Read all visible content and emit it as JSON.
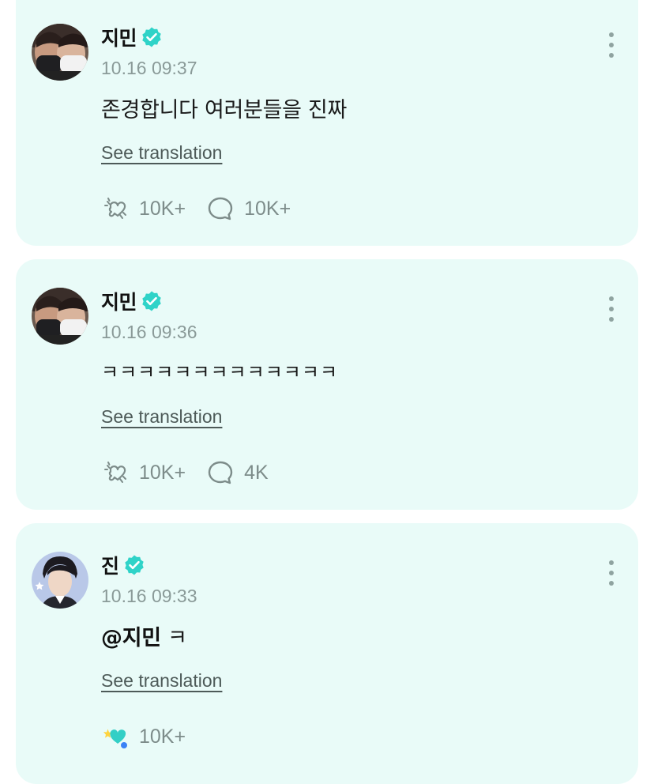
{
  "posts": [
    {
      "author": "지민",
      "verified": true,
      "timestamp": "10.16 09:37",
      "text": "존경합니다 여러분들을 진짜",
      "translate_label": "See translation",
      "reactions": {
        "icon": "heart-outline-icon",
        "count": "10K+"
      },
      "comments": {
        "icon": "comment-bubble-icon",
        "count": "10K+"
      }
    },
    {
      "author": "지민",
      "verified": true,
      "timestamp": "10.16 09:36",
      "text": "ㅋㅋㅋㅋㅋㅋㅋㅋㅋㅋㅋㅋㅋ",
      "translate_label": "See translation",
      "reactions": {
        "icon": "heart-outline-icon",
        "count": "10K+"
      },
      "comments": {
        "icon": "comment-bubble-icon",
        "count": "4K"
      }
    },
    {
      "author": "진",
      "verified": true,
      "timestamp": "10.16 09:33",
      "mention": "@지민",
      "text": " ㅋ",
      "translate_label": "See translation",
      "reactions": {
        "icon": "heart-filled-color-icon",
        "count": "10K+"
      }
    }
  ],
  "colors": {
    "card_background": "#e9fbf8",
    "verified_badge": "#2fd3c8",
    "muted_text": "#8a9a98",
    "icon_gray": "#7d8c8a"
  }
}
